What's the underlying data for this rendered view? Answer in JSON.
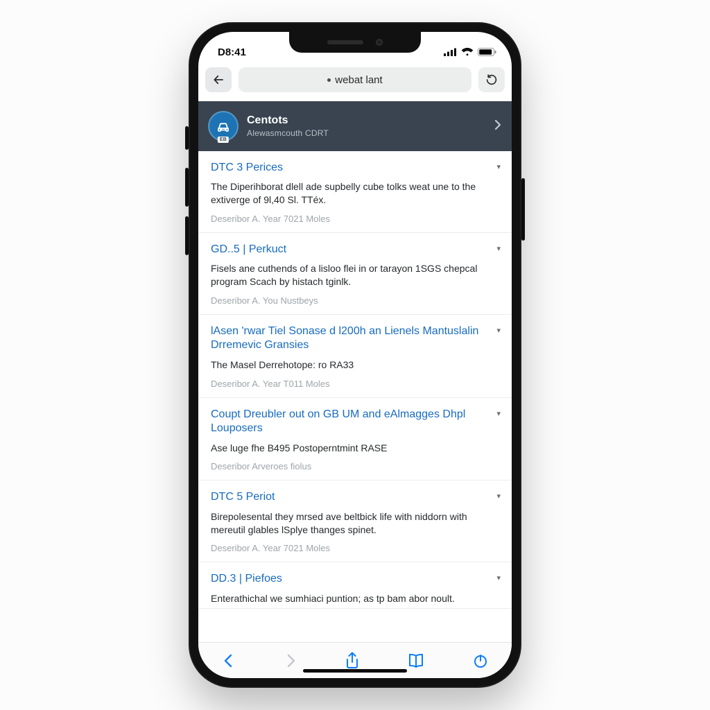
{
  "status": {
    "time": "D8:41"
  },
  "browser": {
    "address": "webat lant"
  },
  "profile": {
    "title": "Centots",
    "subtitle": "Alewasmcouth CDRT",
    "badge": "EB"
  },
  "feed": [
    {
      "title": "DTC 3 Perices",
      "body": "The Diperihborat dlell ade supbelly cube tolks weat une to the extiverge of 9l,40 Sl. TTéx.",
      "meta": "Deseribor A. Year 7021 Moles"
    },
    {
      "title": "GD..5 | Perkuct",
      "body": "Fisels ane cuthends of a lisloo flei in or tarayon 1SGS chepcal program Scach by histach tginlk.",
      "meta": "Deseribor A. You Nustbeys"
    },
    {
      "title": "lAsen 'rwar Tiel Sonase d l200h an Lienels Mantuslalin Drremevic Gransies",
      "body": "The Masel Derrehotope: ro RA33",
      "meta": "Deseribor A. Year T011 Moles"
    },
    {
      "title": "Coupt Dreubler out on GB UM and eAlmagges Dhpl Louposers",
      "body": "Ase luge fhe B495 Postoperntmint RASE",
      "meta": "Deseribor Arveroes fiolus"
    },
    {
      "title": "DTC 5 Periot",
      "body": "Birepolesental they mrsed ave beltbick life with niddorn with mereutil glables lSplye thanges spinet.",
      "meta": "Deseribor A. Year 7021 Moles"
    },
    {
      "title": "DD.3 | Piefoes",
      "body": "Enterathichal we sumhiaci puntion; as tp bam abor noult.",
      "meta": ""
    }
  ]
}
